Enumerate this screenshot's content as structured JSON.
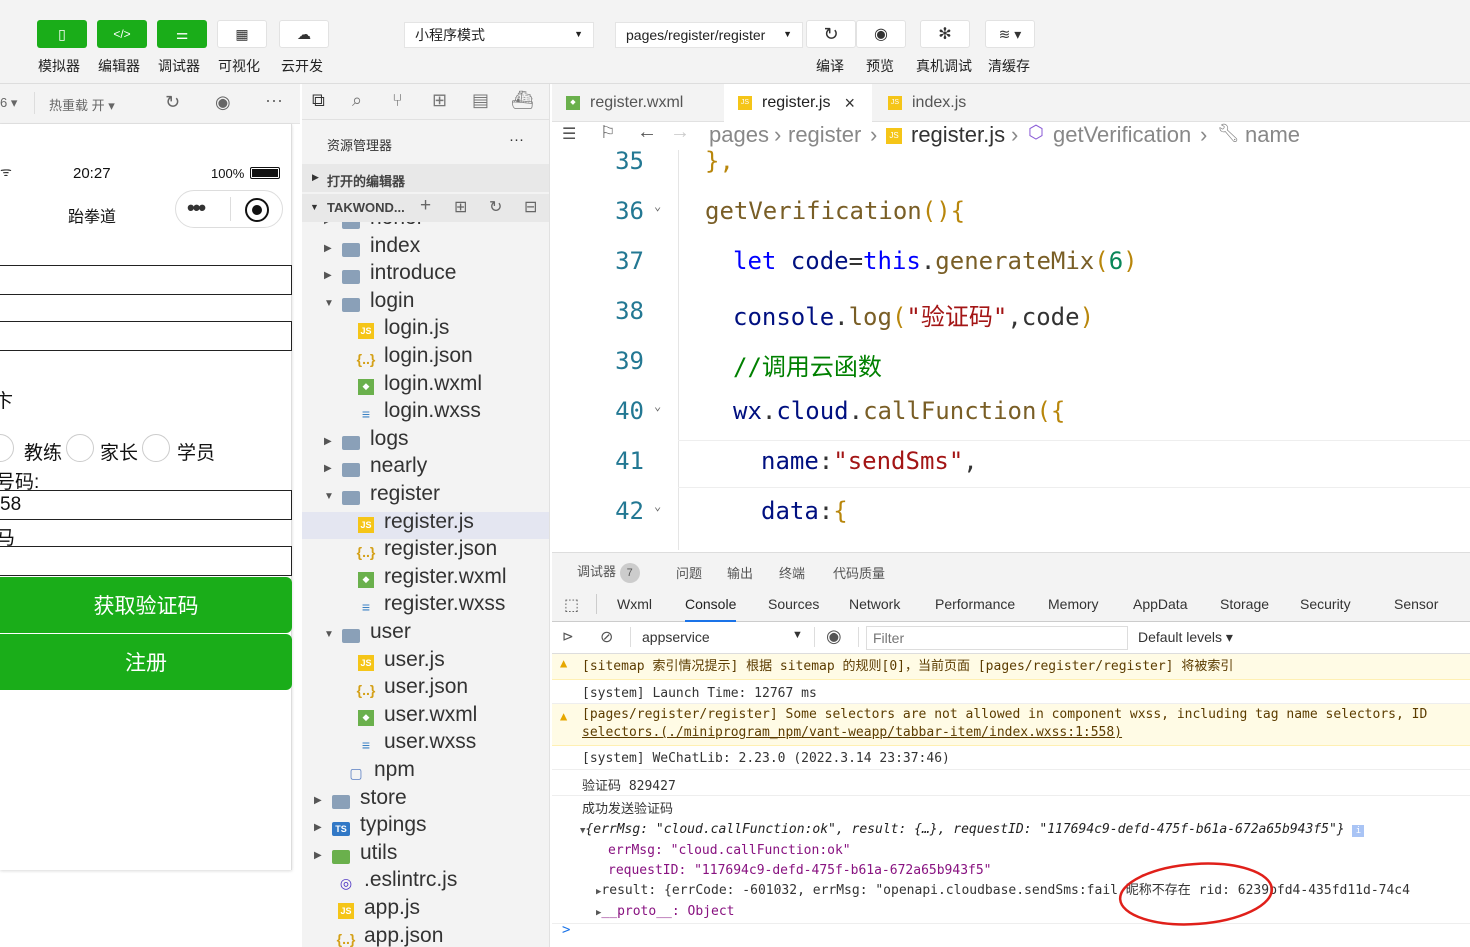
{
  "toolbar": {
    "buttons": [
      {
        "label": "模拟器",
        "icon": "phone-icon"
      },
      {
        "label": "编辑器",
        "icon": "code-icon"
      },
      {
        "label": "调试器",
        "icon": "sliders-icon"
      },
      {
        "label": "可视化",
        "icon": "layout-icon"
      },
      {
        "label": "云开发",
        "icon": "cloud-icon"
      }
    ],
    "mode_select": "小程序模式",
    "page_select": "pages/register/register",
    "right_buttons": [
      {
        "label": "编译",
        "icon": "refresh-icon"
      },
      {
        "label": "预览",
        "icon": "eye-icon"
      },
      {
        "label": "真机调试",
        "icon": "bug-icon"
      },
      {
        "label": "清缓存",
        "icon": "layers-icon"
      }
    ]
  },
  "simbar": {
    "zoom": "6",
    "hot_reload": "热重载 开"
  },
  "sim": {
    "time": "20:27",
    "battery": "100%",
    "title": "跆拳道",
    "role_label_partial": "卞",
    "roles": [
      "教练",
      "家长",
      "学员"
    ],
    "phone_label": "号码:",
    "phone_value": "58",
    "code_label": "马",
    "get_code_button": "获取验证码",
    "register_button": "注册"
  },
  "explorer": {
    "title": "资源管理器",
    "more": "···",
    "open_editors": "打开的编辑器",
    "project": "TAKWOND...",
    "tree": [
      {
        "name": "honor",
        "type": "folder",
        "depth": 1,
        "open": false
      },
      {
        "name": "index",
        "type": "folder",
        "depth": 1,
        "open": false
      },
      {
        "name": "introduce",
        "type": "folder",
        "depth": 1,
        "open": false
      },
      {
        "name": "login",
        "type": "folder",
        "depth": 1,
        "open": true
      },
      {
        "name": "login.js",
        "type": "js",
        "depth": 2
      },
      {
        "name": "login.json",
        "type": "json",
        "depth": 2
      },
      {
        "name": "login.wxml",
        "type": "wxml",
        "depth": 2
      },
      {
        "name": "login.wxss",
        "type": "wxss",
        "depth": 2
      },
      {
        "name": "logs",
        "type": "folder",
        "depth": 1,
        "open": false
      },
      {
        "name": "nearly",
        "type": "folder",
        "depth": 1,
        "open": false
      },
      {
        "name": "register",
        "type": "folder",
        "depth": 1,
        "open": true
      },
      {
        "name": "register.js",
        "type": "js",
        "depth": 2,
        "selected": true
      },
      {
        "name": "register.json",
        "type": "json",
        "depth": 2
      },
      {
        "name": "register.wxml",
        "type": "wxml",
        "depth": 2
      },
      {
        "name": "register.wxss",
        "type": "wxss",
        "depth": 2
      },
      {
        "name": "user",
        "type": "folder",
        "depth": 1,
        "open": true
      },
      {
        "name": "user.js",
        "type": "js",
        "depth": 2
      },
      {
        "name": "user.json",
        "type": "json",
        "depth": 2
      },
      {
        "name": "user.wxml",
        "type": "wxml",
        "depth": 2
      },
      {
        "name": "user.wxss",
        "type": "wxss",
        "depth": 2
      },
      {
        "name": "npm",
        "type": "file",
        "depth": 1
      },
      {
        "name": "store",
        "type": "folder",
        "depth": 0,
        "open": false
      },
      {
        "name": "typings",
        "type": "folder-ts",
        "depth": 0,
        "open": false
      },
      {
        "name": "utils",
        "type": "folder-green",
        "depth": 0,
        "open": false
      },
      {
        "name": ".eslintrc.js",
        "type": "eslint",
        "depth": 0
      },
      {
        "name": "app.js",
        "type": "js",
        "depth": 0
      },
      {
        "name": "app.json",
        "type": "json",
        "depth": 0
      }
    ]
  },
  "editor": {
    "tabs": [
      {
        "name": "register.wxml",
        "type": "wxml",
        "active": false
      },
      {
        "name": "register.js",
        "type": "js",
        "active": true,
        "close": "×"
      },
      {
        "name": "index.js",
        "type": "js",
        "active": false
      }
    ],
    "breadcrumb": [
      "pages",
      "register",
      "register.js",
      "getVerification",
      "name"
    ]
  },
  "code": {
    "lines": [
      {
        "no": "35",
        "tokens": [
          [
            "br",
            "},"
          ]
        ],
        "indent": 0
      },
      {
        "no": "36",
        "tokens": [
          [
            "fn",
            "getVerification"
          ],
          [
            "br",
            "(){"
          ]
        ],
        "indent": 0,
        "fold": true
      },
      {
        "no": "37",
        "tokens": [
          [
            "kw",
            "let "
          ],
          [
            "prop",
            "code"
          ],
          [
            "",
            "="
          ],
          [
            "kw",
            "this"
          ],
          [
            "",
            "."
          ],
          [
            "fn",
            "generateMix"
          ],
          [
            "br",
            "("
          ],
          [
            "num",
            "6"
          ],
          [
            "br",
            ")"
          ]
        ],
        "indent": 1
      },
      {
        "no": "38",
        "tokens": [
          [
            "prop",
            "console"
          ],
          [
            "",
            "."
          ],
          [
            "fn",
            "log"
          ],
          [
            "br",
            "("
          ],
          [
            "str",
            "\"验证码\""
          ],
          [
            "",
            ",code"
          ],
          [
            "br",
            ")"
          ]
        ],
        "indent": 1
      },
      {
        "no": "39",
        "tokens": [
          [
            "cm",
            "//调用云函数"
          ]
        ],
        "indent": 1
      },
      {
        "no": "40",
        "tokens": [
          [
            "prop",
            "wx"
          ],
          [
            "",
            "."
          ],
          [
            "prop",
            "cloud"
          ],
          [
            "",
            "."
          ],
          [
            "fn",
            "callFunction"
          ],
          [
            "br",
            "({"
          ]
        ],
        "indent": 1,
        "fold": true
      },
      {
        "no": "41",
        "tokens": [
          [
            "prop",
            "name"
          ],
          [
            "",
            ":"
          ],
          [
            "str",
            "\"sendSms\""
          ],
          [
            "",
            ","
          ]
        ],
        "indent": 2
      },
      {
        "no": "42",
        "tokens": [
          [
            "prop",
            "data"
          ],
          [
            "",
            ":"
          ],
          [
            "br",
            "{"
          ]
        ],
        "indent": 2,
        "fold": true
      }
    ]
  },
  "devtools": {
    "top_tabs": [
      {
        "label": "调试器",
        "badge": "7"
      },
      {
        "label": "问题"
      },
      {
        "label": "输出"
      },
      {
        "label": "终端"
      },
      {
        "label": "代码质量"
      }
    ],
    "panels": [
      "Wxml",
      "Console",
      "Sources",
      "Network",
      "Performance",
      "Memory",
      "AppData",
      "Storage",
      "Security",
      "Sensor"
    ],
    "active_panel": "Console",
    "context": "appservice",
    "filter_placeholder": "Filter",
    "levels": "Default levels"
  },
  "console": {
    "rows": [
      {
        "kind": "warn",
        "text": "[sitemap 索引情况提示] 根据 sitemap 的规则[0]，当前页面 [pages/register/register] 将被索引"
      },
      {
        "kind": "log",
        "text": "[system] Launch Time: 12767 ms"
      },
      {
        "kind": "warn",
        "text": "[pages/register/register] Some selectors are not allowed in component wxss, including tag name selectors, ID",
        "text2": "selectors.(./miniprogram_npm/vant-weapp/tabbar-item/index.wxss:1:558)"
      },
      {
        "kind": "log",
        "text": "[system] WeChatLib: 2.23.0 (2022.3.14 23:37:46)"
      },
      {
        "kind": "log",
        "text": "验证码 829427"
      }
    ],
    "success_title": "成功发送验证码",
    "obj_summary": "{errMsg: \"cloud.callFunction:ok\", result: {…}, requestID: \"117694c9-defd-475f-b61a-672a65b943f5\"}",
    "errMsg_line": "errMsg: \"cloud.callFunction:ok\"",
    "requestID_line": "requestID: \"117694c9-defd-475f-b61a-672a65b943f5\"",
    "result_line": "result: {errCode: -601032, errMsg: \"openapi.cloudbase.sendSms:fail 昵称不存在  rid: 6239bfd4-435fd11d-74c4",
    "proto_line": "__proto__: Object",
    "prompt": ">",
    "annotation_color": "#e0201a"
  }
}
